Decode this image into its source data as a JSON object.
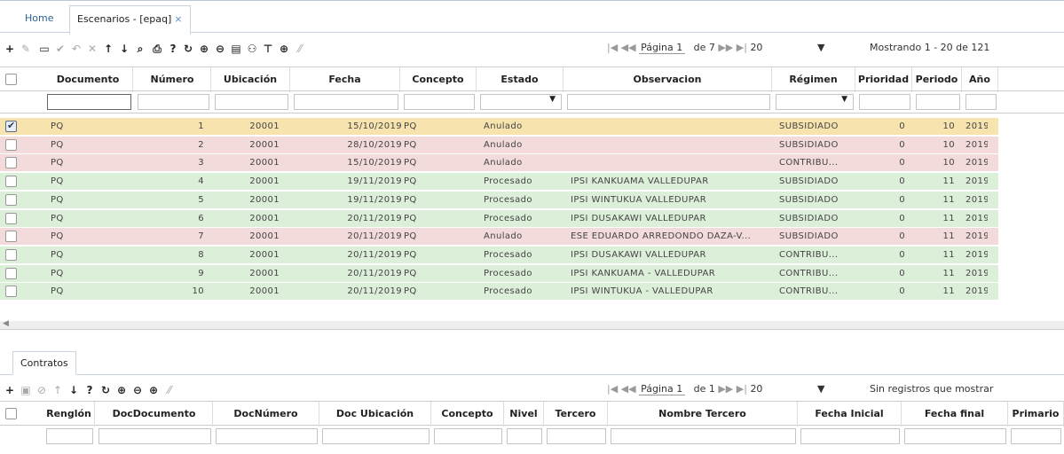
{
  "tabs": {
    "home": "Home",
    "active": "Escenarios - [epaq]",
    "close": "×"
  },
  "toolbar_top": {
    "page_label": "Página 1",
    "of_label": "de 7",
    "per_page": "20",
    "showing": "Mostrando 1 - 20 de 121",
    "nav_first": "|◀",
    "nav_prev": "◀◀",
    "nav_next": "▶▶",
    "nav_last": "▶|",
    "dropdown": "▼"
  },
  "grid_headers": [
    "Documento",
    "Número",
    "Ubicación",
    "Fecha",
    "Concepto",
    "Estado",
    "Observacion",
    "Régimen",
    "Prioridad",
    "Periodo",
    "Año"
  ],
  "filter_dropdown": "▼",
  "rows": [
    {
      "doc": "PQ",
      "num": "1",
      "ubi": "20001",
      "fecha": "15/10/2019",
      "concepto": "PQ",
      "estado": "Anulado",
      "obs": "",
      "regimen": "SUBSIDIADO",
      "prioridad": "0",
      "periodo": "10",
      "anio": "2019",
      "checked": true,
      "color": "y"
    },
    {
      "doc": "PQ",
      "num": "2",
      "ubi": "20001",
      "fecha": "28/10/2019",
      "concepto": "PQ",
      "estado": "Anulado",
      "obs": "",
      "regimen": "SUBSIDIADO",
      "prioridad": "0",
      "periodo": "10",
      "anio": "2019",
      "checked": false,
      "color": "rd"
    },
    {
      "doc": "PQ",
      "num": "3",
      "ubi": "20001",
      "fecha": "15/10/2019",
      "concepto": "PQ",
      "estado": "Anulado",
      "obs": "",
      "regimen": "CONTRIBU...",
      "prioridad": "0",
      "periodo": "10",
      "anio": "2019",
      "checked": false,
      "color": "rd"
    },
    {
      "doc": "PQ",
      "num": "4",
      "ubi": "20001",
      "fecha": "19/11/2019",
      "concepto": "PQ",
      "estado": "Procesado",
      "obs": "IPSI KANKUAMA VALLEDUPAR",
      "regimen": "SUBSIDIADO",
      "prioridad": "0",
      "periodo": "11",
      "anio": "2019",
      "checked": false,
      "color": "g"
    },
    {
      "doc": "PQ",
      "num": "5",
      "ubi": "20001",
      "fecha": "19/11/2019",
      "concepto": "PQ",
      "estado": "Procesado",
      "obs": "IPSI WINTUKUA VALLEDUPAR",
      "regimen": "SUBSIDIADO",
      "prioridad": "0",
      "periodo": "11",
      "anio": "2019",
      "checked": false,
      "color": "g"
    },
    {
      "doc": "PQ",
      "num": "6",
      "ubi": "20001",
      "fecha": "20/11/2019",
      "concepto": "PQ",
      "estado": "Procesado",
      "obs": "IPSI DUSAKAWI VALLEDUPAR",
      "regimen": "SUBSIDIADO",
      "prioridad": "0",
      "periodo": "11",
      "anio": "2019",
      "checked": false,
      "color": "g"
    },
    {
      "doc": "PQ",
      "num": "7",
      "ubi": "20001",
      "fecha": "20/11/2019",
      "concepto": "PQ",
      "estado": "Anulado",
      "obs": "ESE EDUARDO ARREDONDO DAZA-V...",
      "regimen": "SUBSIDIADO",
      "prioridad": "0",
      "periodo": "11",
      "anio": "2019",
      "checked": false,
      "color": "rd"
    },
    {
      "doc": "PQ",
      "num": "8",
      "ubi": "20001",
      "fecha": "20/11/2019",
      "concepto": "PQ",
      "estado": "Procesado",
      "obs": "IPSI DUSAKAWI VALLEDUPAR",
      "regimen": "CONTRIBU...",
      "prioridad": "0",
      "periodo": "11",
      "anio": "2019",
      "checked": false,
      "color": "g"
    },
    {
      "doc": "PQ",
      "num": "9",
      "ubi": "20001",
      "fecha": "20/11/2019",
      "concepto": "PQ",
      "estado": "Procesado",
      "obs": "IPSI KANKUAMA - VALLEDUPAR",
      "regimen": "CONTRIBU...",
      "prioridad": "0",
      "periodo": "11",
      "anio": "2019",
      "checked": false,
      "color": "g"
    },
    {
      "doc": "PQ",
      "num": "10",
      "ubi": "20001",
      "fecha": "20/11/2019",
      "concepto": "PQ",
      "estado": "Procesado",
      "obs": "IPSI WINTUKUA - VALLEDUPAR",
      "regimen": "CONTRIBU...",
      "prioridad": "0",
      "periodo": "11",
      "anio": "2019",
      "checked": false,
      "color": "g"
    }
  ],
  "subtab": "Contratos",
  "toolbar_bottom": {
    "page_label": "Página 1",
    "of_label": "de 1",
    "per_page": "20",
    "showing": "Sin registros que mostrar"
  },
  "sub_headers": [
    "Renglón",
    "DocDocumento",
    "DocNúmero",
    "Doc Ubicación",
    "Concepto",
    "Nivel",
    "Tercero",
    "Nombre Tercero",
    "Fecha Inicial",
    "Fecha final",
    "Primario"
  ],
  "colors": {
    "approved": "#dcefd9",
    "cancelled": "#f3dadb",
    "selected": "#f6e3ae",
    "link": "#2d5f8f"
  }
}
